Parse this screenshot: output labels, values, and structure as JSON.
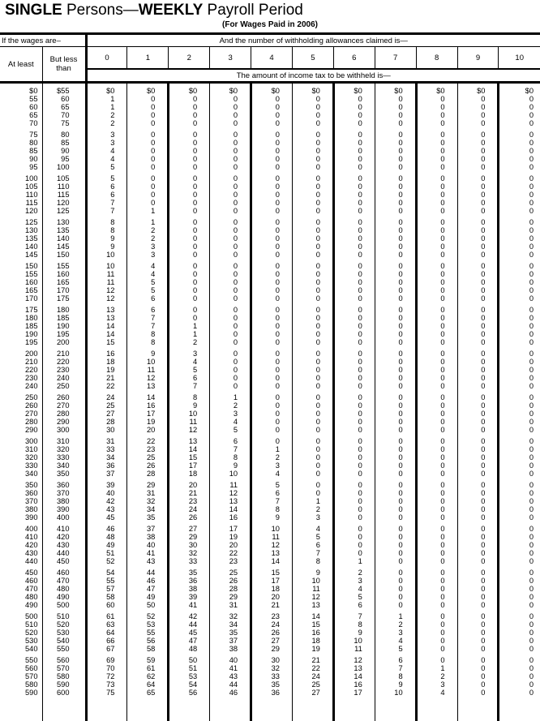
{
  "title": {
    "part1_bold": "SINGLE",
    "part2": " Persons—",
    "part3_bold": "WEEKLY",
    "part4": " Payroll Period"
  },
  "subtitle": "(For Wages Paid in 2006)",
  "header": {
    "wages_label": "If the wages are–",
    "allowances_label": "And the number of withholding allowances claimed is—",
    "at_least": "At least",
    "but_less_than": "But less than",
    "allowance_numbers": [
      "0",
      "1",
      "2",
      "3",
      "4",
      "5",
      "6",
      "7",
      "8",
      "9",
      "10"
    ],
    "amount_label": "The amount of income tax to be withheld is—"
  },
  "rows": [
    {
      "at_least": "$0",
      "but_less": "$55",
      "tax": [
        "$0",
        "$0",
        "$0",
        "$0",
        "$0",
        "$0",
        "$0",
        "$0",
        "$0",
        "$0",
        "$0"
      ]
    },
    {
      "at_least": "55",
      "but_less": "60",
      "tax": [
        "1",
        "0",
        "0",
        "0",
        "0",
        "0",
        "0",
        "0",
        "0",
        "0",
        "0"
      ]
    },
    {
      "at_least": "60",
      "but_less": "65",
      "tax": [
        "1",
        "0",
        "0",
        "0",
        "0",
        "0",
        "0",
        "0",
        "0",
        "0",
        "0"
      ]
    },
    {
      "at_least": "65",
      "but_less": "70",
      "tax": [
        "2",
        "0",
        "0",
        "0",
        "0",
        "0",
        "0",
        "0",
        "0",
        "0",
        "0"
      ]
    },
    {
      "at_least": "70",
      "but_less": "75",
      "tax": [
        "2",
        "0",
        "0",
        "0",
        "0",
        "0",
        "0",
        "0",
        "0",
        "0",
        "0"
      ]
    },
    {
      "at_least": "75",
      "but_less": "80",
      "tax": [
        "3",
        "0",
        "0",
        "0",
        "0",
        "0",
        "0",
        "0",
        "0",
        "0",
        "0"
      ]
    },
    {
      "at_least": "80",
      "but_less": "85",
      "tax": [
        "3",
        "0",
        "0",
        "0",
        "0",
        "0",
        "0",
        "0",
        "0",
        "0",
        "0"
      ]
    },
    {
      "at_least": "85",
      "but_less": "90",
      "tax": [
        "4",
        "0",
        "0",
        "0",
        "0",
        "0",
        "0",
        "0",
        "0",
        "0",
        "0"
      ]
    },
    {
      "at_least": "90",
      "but_less": "95",
      "tax": [
        "4",
        "0",
        "0",
        "0",
        "0",
        "0",
        "0",
        "0",
        "0",
        "0",
        "0"
      ]
    },
    {
      "at_least": "95",
      "but_less": "100",
      "tax": [
        "5",
        "0",
        "0",
        "0",
        "0",
        "0",
        "0",
        "0",
        "0",
        "0",
        "0"
      ]
    },
    {
      "at_least": "100",
      "but_less": "105",
      "tax": [
        "5",
        "0",
        "0",
        "0",
        "0",
        "0",
        "0",
        "0",
        "0",
        "0",
        "0"
      ]
    },
    {
      "at_least": "105",
      "but_less": "110",
      "tax": [
        "6",
        "0",
        "0",
        "0",
        "0",
        "0",
        "0",
        "0",
        "0",
        "0",
        "0"
      ]
    },
    {
      "at_least": "110",
      "but_less": "115",
      "tax": [
        "6",
        "0",
        "0",
        "0",
        "0",
        "0",
        "0",
        "0",
        "0",
        "0",
        "0"
      ]
    },
    {
      "at_least": "115",
      "but_less": "120",
      "tax": [
        "7",
        "0",
        "0",
        "0",
        "0",
        "0",
        "0",
        "0",
        "0",
        "0",
        "0"
      ]
    },
    {
      "at_least": "120",
      "but_less": "125",
      "tax": [
        "7",
        "1",
        "0",
        "0",
        "0",
        "0",
        "0",
        "0",
        "0",
        "0",
        "0"
      ]
    },
    {
      "at_least": "125",
      "but_less": "130",
      "tax": [
        "8",
        "1",
        "0",
        "0",
        "0",
        "0",
        "0",
        "0",
        "0",
        "0",
        "0"
      ]
    },
    {
      "at_least": "130",
      "but_less": "135",
      "tax": [
        "8",
        "2",
        "0",
        "0",
        "0",
        "0",
        "0",
        "0",
        "0",
        "0",
        "0"
      ]
    },
    {
      "at_least": "135",
      "but_less": "140",
      "tax": [
        "9",
        "2",
        "0",
        "0",
        "0",
        "0",
        "0",
        "0",
        "0",
        "0",
        "0"
      ]
    },
    {
      "at_least": "140",
      "but_less": "145",
      "tax": [
        "9",
        "3",
        "0",
        "0",
        "0",
        "0",
        "0",
        "0",
        "0",
        "0",
        "0"
      ]
    },
    {
      "at_least": "145",
      "but_less": "150",
      "tax": [
        "10",
        "3",
        "0",
        "0",
        "0",
        "0",
        "0",
        "0",
        "0",
        "0",
        "0"
      ]
    },
    {
      "at_least": "150",
      "but_less": "155",
      "tax": [
        "10",
        "4",
        "0",
        "0",
        "0",
        "0",
        "0",
        "0",
        "0",
        "0",
        "0"
      ]
    },
    {
      "at_least": "155",
      "but_less": "160",
      "tax": [
        "11",
        "4",
        "0",
        "0",
        "0",
        "0",
        "0",
        "0",
        "0",
        "0",
        "0"
      ]
    },
    {
      "at_least": "160",
      "but_less": "165",
      "tax": [
        "11",
        "5",
        "0",
        "0",
        "0",
        "0",
        "0",
        "0",
        "0",
        "0",
        "0"
      ]
    },
    {
      "at_least": "165",
      "but_less": "170",
      "tax": [
        "12",
        "5",
        "0",
        "0",
        "0",
        "0",
        "0",
        "0",
        "0",
        "0",
        "0"
      ]
    },
    {
      "at_least": "170",
      "but_less": "175",
      "tax": [
        "12",
        "6",
        "0",
        "0",
        "0",
        "0",
        "0",
        "0",
        "0",
        "0",
        "0"
      ]
    },
    {
      "at_least": "175",
      "but_less": "180",
      "tax": [
        "13",
        "6",
        "0",
        "0",
        "0",
        "0",
        "0",
        "0",
        "0",
        "0",
        "0"
      ]
    },
    {
      "at_least": "180",
      "but_less": "185",
      "tax": [
        "13",
        "7",
        "0",
        "0",
        "0",
        "0",
        "0",
        "0",
        "0",
        "0",
        "0"
      ]
    },
    {
      "at_least": "185",
      "but_less": "190",
      "tax": [
        "14",
        "7",
        "1",
        "0",
        "0",
        "0",
        "0",
        "0",
        "0",
        "0",
        "0"
      ]
    },
    {
      "at_least": "190",
      "but_less": "195",
      "tax": [
        "14",
        "8",
        "1",
        "0",
        "0",
        "0",
        "0",
        "0",
        "0",
        "0",
        "0"
      ]
    },
    {
      "at_least": "195",
      "but_less": "200",
      "tax": [
        "15",
        "8",
        "2",
        "0",
        "0",
        "0",
        "0",
        "0",
        "0",
        "0",
        "0"
      ]
    },
    {
      "at_least": "200",
      "but_less": "210",
      "tax": [
        "16",
        "9",
        "3",
        "0",
        "0",
        "0",
        "0",
        "0",
        "0",
        "0",
        "0"
      ]
    },
    {
      "at_least": "210",
      "but_less": "220",
      "tax": [
        "18",
        "10",
        "4",
        "0",
        "0",
        "0",
        "0",
        "0",
        "0",
        "0",
        "0"
      ]
    },
    {
      "at_least": "220",
      "but_less": "230",
      "tax": [
        "19",
        "11",
        "5",
        "0",
        "0",
        "0",
        "0",
        "0",
        "0",
        "0",
        "0"
      ]
    },
    {
      "at_least": "230",
      "but_less": "240",
      "tax": [
        "21",
        "12",
        "6",
        "0",
        "0",
        "0",
        "0",
        "0",
        "0",
        "0",
        "0"
      ]
    },
    {
      "at_least": "240",
      "but_less": "250",
      "tax": [
        "22",
        "13",
        "7",
        "0",
        "0",
        "0",
        "0",
        "0",
        "0",
        "0",
        "0"
      ]
    },
    {
      "at_least": "250",
      "but_less": "260",
      "tax": [
        "24",
        "14",
        "8",
        "1",
        "0",
        "0",
        "0",
        "0",
        "0",
        "0",
        "0"
      ]
    },
    {
      "at_least": "260",
      "but_less": "270",
      "tax": [
        "25",
        "16",
        "9",
        "2",
        "0",
        "0",
        "0",
        "0",
        "0",
        "0",
        "0"
      ]
    },
    {
      "at_least": "270",
      "but_less": "280",
      "tax": [
        "27",
        "17",
        "10",
        "3",
        "0",
        "0",
        "0",
        "0",
        "0",
        "0",
        "0"
      ]
    },
    {
      "at_least": "280",
      "but_less": "290",
      "tax": [
        "28",
        "19",
        "11",
        "4",
        "0",
        "0",
        "0",
        "0",
        "0",
        "0",
        "0"
      ]
    },
    {
      "at_least": "290",
      "but_less": "300",
      "tax": [
        "30",
        "20",
        "12",
        "5",
        "0",
        "0",
        "0",
        "0",
        "0",
        "0",
        "0"
      ]
    },
    {
      "at_least": "300",
      "but_less": "310",
      "tax": [
        "31",
        "22",
        "13",
        "6",
        "0",
        "0",
        "0",
        "0",
        "0",
        "0",
        "0"
      ]
    },
    {
      "at_least": "310",
      "but_less": "320",
      "tax": [
        "33",
        "23",
        "14",
        "7",
        "1",
        "0",
        "0",
        "0",
        "0",
        "0",
        "0"
      ]
    },
    {
      "at_least": "320",
      "but_less": "330",
      "tax": [
        "34",
        "25",
        "15",
        "8",
        "2",
        "0",
        "0",
        "0",
        "0",
        "0",
        "0"
      ]
    },
    {
      "at_least": "330",
      "but_less": "340",
      "tax": [
        "36",
        "26",
        "17",
        "9",
        "3",
        "0",
        "0",
        "0",
        "0",
        "0",
        "0"
      ]
    },
    {
      "at_least": "340",
      "but_less": "350",
      "tax": [
        "37",
        "28",
        "18",
        "10",
        "4",
        "0",
        "0",
        "0",
        "0",
        "0",
        "0"
      ]
    },
    {
      "at_least": "350",
      "but_less": "360",
      "tax": [
        "39",
        "29",
        "20",
        "11",
        "5",
        "0",
        "0",
        "0",
        "0",
        "0",
        "0"
      ]
    },
    {
      "at_least": "360",
      "but_less": "370",
      "tax": [
        "40",
        "31",
        "21",
        "12",
        "6",
        "0",
        "0",
        "0",
        "0",
        "0",
        "0"
      ]
    },
    {
      "at_least": "370",
      "but_less": "380",
      "tax": [
        "42",
        "32",
        "23",
        "13",
        "7",
        "1",
        "0",
        "0",
        "0",
        "0",
        "0"
      ]
    },
    {
      "at_least": "380",
      "but_less": "390",
      "tax": [
        "43",
        "34",
        "24",
        "14",
        "8",
        "2",
        "0",
        "0",
        "0",
        "0",
        "0"
      ]
    },
    {
      "at_least": "390",
      "but_less": "400",
      "tax": [
        "45",
        "35",
        "26",
        "16",
        "9",
        "3",
        "0",
        "0",
        "0",
        "0",
        "0"
      ]
    },
    {
      "at_least": "400",
      "but_less": "410",
      "tax": [
        "46",
        "37",
        "27",
        "17",
        "10",
        "4",
        "0",
        "0",
        "0",
        "0",
        "0"
      ]
    },
    {
      "at_least": "410",
      "but_less": "420",
      "tax": [
        "48",
        "38",
        "29",
        "19",
        "11",
        "5",
        "0",
        "0",
        "0",
        "0",
        "0"
      ]
    },
    {
      "at_least": "420",
      "but_less": "430",
      "tax": [
        "49",
        "40",
        "30",
        "20",
        "12",
        "6",
        "0",
        "0",
        "0",
        "0",
        "0"
      ]
    },
    {
      "at_least": "430",
      "but_less": "440",
      "tax": [
        "51",
        "41",
        "32",
        "22",
        "13",
        "7",
        "0",
        "0",
        "0",
        "0",
        "0"
      ]
    },
    {
      "at_least": "440",
      "but_less": "450",
      "tax": [
        "52",
        "43",
        "33",
        "23",
        "14",
        "8",
        "1",
        "0",
        "0",
        "0",
        "0"
      ]
    },
    {
      "at_least": "450",
      "but_less": "460",
      "tax": [
        "54",
        "44",
        "35",
        "25",
        "15",
        "9",
        "2",
        "0",
        "0",
        "0",
        "0"
      ]
    },
    {
      "at_least": "460",
      "but_less": "470",
      "tax": [
        "55",
        "46",
        "36",
        "26",
        "17",
        "10",
        "3",
        "0",
        "0",
        "0",
        "0"
      ]
    },
    {
      "at_least": "470",
      "but_less": "480",
      "tax": [
        "57",
        "47",
        "38",
        "28",
        "18",
        "11",
        "4",
        "0",
        "0",
        "0",
        "0"
      ]
    },
    {
      "at_least": "480",
      "but_less": "490",
      "tax": [
        "58",
        "49",
        "39",
        "29",
        "20",
        "12",
        "5",
        "0",
        "0",
        "0",
        "0"
      ]
    },
    {
      "at_least": "490",
      "but_less": "500",
      "tax": [
        "60",
        "50",
        "41",
        "31",
        "21",
        "13",
        "6",
        "0",
        "0",
        "0",
        "0"
      ]
    },
    {
      "at_least": "500",
      "but_less": "510",
      "tax": [
        "61",
        "52",
        "42",
        "32",
        "23",
        "14",
        "7",
        "1",
        "0",
        "0",
        "0"
      ]
    },
    {
      "at_least": "510",
      "but_less": "520",
      "tax": [
        "63",
        "53",
        "44",
        "34",
        "24",
        "15",
        "8",
        "2",
        "0",
        "0",
        "0"
      ]
    },
    {
      "at_least": "520",
      "but_less": "530",
      "tax": [
        "64",
        "55",
        "45",
        "35",
        "26",
        "16",
        "9",
        "3",
        "0",
        "0",
        "0"
      ]
    },
    {
      "at_least": "530",
      "but_less": "540",
      "tax": [
        "66",
        "56",
        "47",
        "37",
        "27",
        "18",
        "10",
        "4",
        "0",
        "0",
        "0"
      ]
    },
    {
      "at_least": "540",
      "but_less": "550",
      "tax": [
        "67",
        "58",
        "48",
        "38",
        "29",
        "19",
        "11",
        "5",
        "0",
        "0",
        "0"
      ]
    },
    {
      "at_least": "550",
      "but_less": "560",
      "tax": [
        "69",
        "59",
        "50",
        "40",
        "30",
        "21",
        "12",
        "6",
        "0",
        "0",
        "0"
      ]
    },
    {
      "at_least": "560",
      "but_less": "570",
      "tax": [
        "70",
        "61",
        "51",
        "41",
        "32",
        "22",
        "13",
        "7",
        "1",
        "0",
        "0"
      ]
    },
    {
      "at_least": "570",
      "but_less": "580",
      "tax": [
        "72",
        "62",
        "53",
        "43",
        "33",
        "24",
        "14",
        "8",
        "2",
        "0",
        "0"
      ]
    },
    {
      "at_least": "580",
      "but_less": "590",
      "tax": [
        "73",
        "64",
        "54",
        "44",
        "35",
        "25",
        "16",
        "9",
        "3",
        "0",
        "0"
      ]
    },
    {
      "at_least": "590",
      "but_less": "600",
      "tax": [
        "75",
        "65",
        "56",
        "46",
        "36",
        "27",
        "17",
        "10",
        "4",
        "0",
        "0"
      ]
    }
  ]
}
